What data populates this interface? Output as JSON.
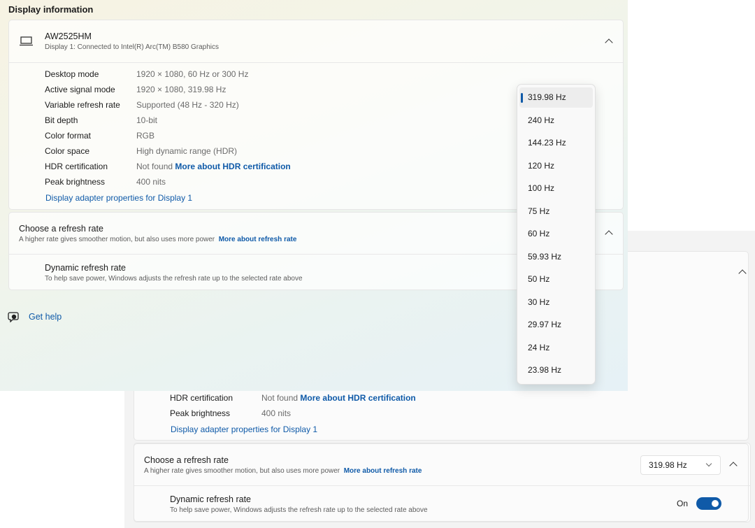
{
  "section_title": "Display information",
  "display": {
    "name": "AW2525HM",
    "subtitle": "Display 1: Connected to Intel(R) Arc(TM) B580 Graphics",
    "icon": "laptop-icon"
  },
  "info_rows": [
    {
      "label": "Desktop mode",
      "value": "1920 × 1080, 60 Hz or 300 Hz"
    },
    {
      "label": "Active signal mode",
      "value": "1920 × 1080, 319.98 Hz"
    },
    {
      "label": "Variable refresh rate",
      "value": "Supported (48 Hz - 320 Hz)"
    },
    {
      "label": "Bit depth",
      "value": "10-bit"
    },
    {
      "label": "Color format",
      "value": "RGB"
    },
    {
      "label": "Color space",
      "value": "High dynamic range (HDR)"
    },
    {
      "label": "HDR certification",
      "value": "Not found",
      "link": "More about HDR certification"
    },
    {
      "label": "Peak brightness",
      "value": "400 nits"
    }
  ],
  "adapter_link": "Display adapter properties for Display 1",
  "refresh": {
    "title": "Choose a refresh rate",
    "subtitle": "A higher rate gives smoother motion, but also uses more power",
    "link": "More about refresh rate",
    "selected": "319.98 Hz"
  },
  "dynamic": {
    "title": "Dynamic refresh rate",
    "subtitle": "To help save power, Windows adjusts the refresh rate up to the selected rate above",
    "state": "On"
  },
  "help": {
    "label": "Get help",
    "icon": "help-chat-icon"
  },
  "rate_options": [
    "319.98 Hz",
    "240 Hz",
    "144.23 Hz",
    "120 Hz",
    "100 Hz",
    "75 Hz",
    "60 Hz",
    "59.93 Hz",
    "50 Hz",
    "30 Hz",
    "29.97 Hz",
    "24 Hz",
    "23.98 Hz"
  ],
  "colors": {
    "accent": "#0f5aa8"
  }
}
